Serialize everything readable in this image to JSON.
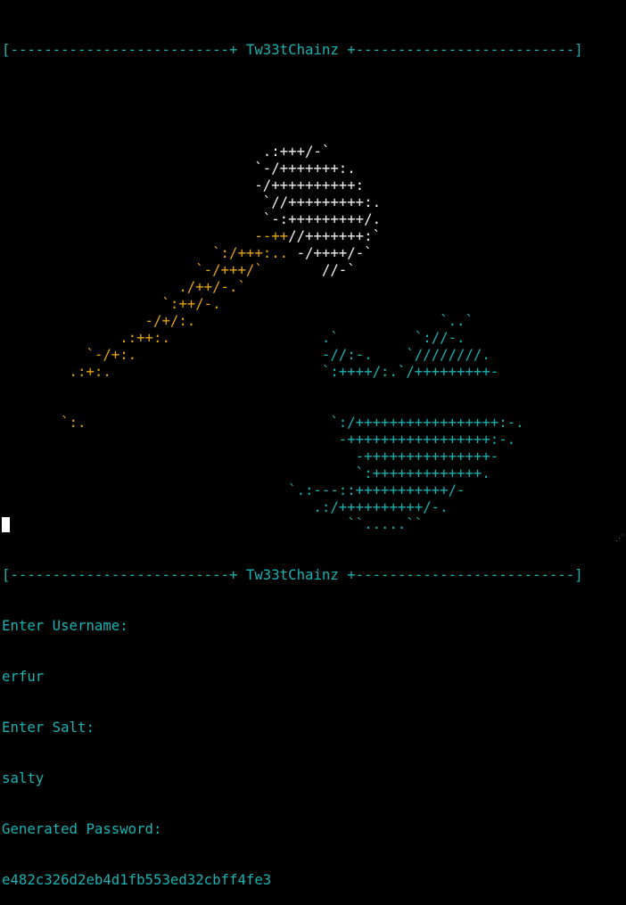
{
  "header": {
    "banner_top": "[--------------------------+ Tw33tChainz +--------------------------]",
    "banner_bottom": "[--------------------------+ Tw33tChainz +--------------------------]"
  },
  "colors": {
    "cyan": "#18b2b2",
    "white": "#f2f2f2",
    "orange": "#e5a50a",
    "background": "#000000"
  },
  "art": {
    "bird": [
      [
        "",
        "",
        "                               .:+++/-`"
      ],
      [
        "",
        "",
        "                              `-/+++++++:."
      ],
      [
        "",
        "",
        "                              -/++++++++++:"
      ],
      [
        "",
        "",
        "                               `//+++++++++:."
      ],
      [
        "",
        "",
        "                               `-:+++++++++/."
      ],
      [
        "",
        "                              --++",
        "//+++++++:`"
      ],
      [
        "",
        "                         `:/+++:.. ",
        "-/++++/-`"
      ],
      [
        "",
        "                       `-/+++/`       ",
        "//-`"
      ],
      [
        "",
        "                     ./++/-.`",
        ""
      ],
      [
        "",
        "                   `:++/-.",
        ""
      ],
      [
        "",
        "                 -/+/:.",
        ""
      ],
      [
        "",
        "              .:++:.",
        ""
      ],
      [
        "",
        "          `-/+:.",
        ""
      ],
      [
        "",
        "        .:+:.",
        ""
      ]
    ],
    "cloud": [
      "                                                    `..`",
      "                                      .`         `://-.",
      "                                      -//:-.    `////////.",
      "                                      `:++++/:.`/+++++++++-",
      "                                       `:/+++++++++++++++++:-.",
      "                                        -+++++++++++++++++:-.",
      "                                          -+++++++++++++++-",
      "                                          `:+++++++++++++.",
      "                                  `.:---::+++++++++++/-",
      "                                     .:/++++++++++/-.",
      "                                         ``.....``"
    ],
    "trail_tail": "       `:."
  },
  "session": {
    "username_prompt": "Enter Username:",
    "username_value": "erfur",
    "salt_prompt": "Enter Salt:",
    "salt_value": "salty",
    "password_prompt": "Generated Password:",
    "password_value": "e482c326d2eb4d1fb553ed32cbff4fe3"
  }
}
